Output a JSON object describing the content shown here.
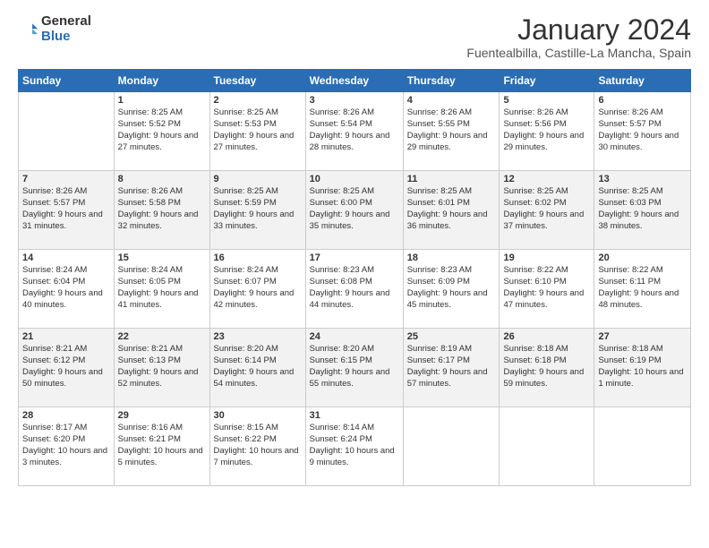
{
  "header": {
    "logo_general": "General",
    "logo_blue": "Blue",
    "month_title": "January 2024",
    "location": "Fuentealbilla, Castille-La Mancha, Spain"
  },
  "weekdays": [
    "Sunday",
    "Monday",
    "Tuesday",
    "Wednesday",
    "Thursday",
    "Friday",
    "Saturday"
  ],
  "weeks": [
    [
      {
        "num": "",
        "sunrise": "",
        "sunset": "",
        "daylight": ""
      },
      {
        "num": "1",
        "sunrise": "Sunrise: 8:25 AM",
        "sunset": "Sunset: 5:52 PM",
        "daylight": "Daylight: 9 hours and 27 minutes."
      },
      {
        "num": "2",
        "sunrise": "Sunrise: 8:25 AM",
        "sunset": "Sunset: 5:53 PM",
        "daylight": "Daylight: 9 hours and 27 minutes."
      },
      {
        "num": "3",
        "sunrise": "Sunrise: 8:26 AM",
        "sunset": "Sunset: 5:54 PM",
        "daylight": "Daylight: 9 hours and 28 minutes."
      },
      {
        "num": "4",
        "sunrise": "Sunrise: 8:26 AM",
        "sunset": "Sunset: 5:55 PM",
        "daylight": "Daylight: 9 hours and 29 minutes."
      },
      {
        "num": "5",
        "sunrise": "Sunrise: 8:26 AM",
        "sunset": "Sunset: 5:56 PM",
        "daylight": "Daylight: 9 hours and 29 minutes."
      },
      {
        "num": "6",
        "sunrise": "Sunrise: 8:26 AM",
        "sunset": "Sunset: 5:57 PM",
        "daylight": "Daylight: 9 hours and 30 minutes."
      }
    ],
    [
      {
        "num": "7",
        "sunrise": "Sunrise: 8:26 AM",
        "sunset": "Sunset: 5:57 PM",
        "daylight": "Daylight: 9 hours and 31 minutes."
      },
      {
        "num": "8",
        "sunrise": "Sunrise: 8:26 AM",
        "sunset": "Sunset: 5:58 PM",
        "daylight": "Daylight: 9 hours and 32 minutes."
      },
      {
        "num": "9",
        "sunrise": "Sunrise: 8:25 AM",
        "sunset": "Sunset: 5:59 PM",
        "daylight": "Daylight: 9 hours and 33 minutes."
      },
      {
        "num": "10",
        "sunrise": "Sunrise: 8:25 AM",
        "sunset": "Sunset: 6:00 PM",
        "daylight": "Daylight: 9 hours and 35 minutes."
      },
      {
        "num": "11",
        "sunrise": "Sunrise: 8:25 AM",
        "sunset": "Sunset: 6:01 PM",
        "daylight": "Daylight: 9 hours and 36 minutes."
      },
      {
        "num": "12",
        "sunrise": "Sunrise: 8:25 AM",
        "sunset": "Sunset: 6:02 PM",
        "daylight": "Daylight: 9 hours and 37 minutes."
      },
      {
        "num": "13",
        "sunrise": "Sunrise: 8:25 AM",
        "sunset": "Sunset: 6:03 PM",
        "daylight": "Daylight: 9 hours and 38 minutes."
      }
    ],
    [
      {
        "num": "14",
        "sunrise": "Sunrise: 8:24 AM",
        "sunset": "Sunset: 6:04 PM",
        "daylight": "Daylight: 9 hours and 40 minutes."
      },
      {
        "num": "15",
        "sunrise": "Sunrise: 8:24 AM",
        "sunset": "Sunset: 6:05 PM",
        "daylight": "Daylight: 9 hours and 41 minutes."
      },
      {
        "num": "16",
        "sunrise": "Sunrise: 8:24 AM",
        "sunset": "Sunset: 6:07 PM",
        "daylight": "Daylight: 9 hours and 42 minutes."
      },
      {
        "num": "17",
        "sunrise": "Sunrise: 8:23 AM",
        "sunset": "Sunset: 6:08 PM",
        "daylight": "Daylight: 9 hours and 44 minutes."
      },
      {
        "num": "18",
        "sunrise": "Sunrise: 8:23 AM",
        "sunset": "Sunset: 6:09 PM",
        "daylight": "Daylight: 9 hours and 45 minutes."
      },
      {
        "num": "19",
        "sunrise": "Sunrise: 8:22 AM",
        "sunset": "Sunset: 6:10 PM",
        "daylight": "Daylight: 9 hours and 47 minutes."
      },
      {
        "num": "20",
        "sunrise": "Sunrise: 8:22 AM",
        "sunset": "Sunset: 6:11 PM",
        "daylight": "Daylight: 9 hours and 48 minutes."
      }
    ],
    [
      {
        "num": "21",
        "sunrise": "Sunrise: 8:21 AM",
        "sunset": "Sunset: 6:12 PM",
        "daylight": "Daylight: 9 hours and 50 minutes."
      },
      {
        "num": "22",
        "sunrise": "Sunrise: 8:21 AM",
        "sunset": "Sunset: 6:13 PM",
        "daylight": "Daylight: 9 hours and 52 minutes."
      },
      {
        "num": "23",
        "sunrise": "Sunrise: 8:20 AM",
        "sunset": "Sunset: 6:14 PM",
        "daylight": "Daylight: 9 hours and 54 minutes."
      },
      {
        "num": "24",
        "sunrise": "Sunrise: 8:20 AM",
        "sunset": "Sunset: 6:15 PM",
        "daylight": "Daylight: 9 hours and 55 minutes."
      },
      {
        "num": "25",
        "sunrise": "Sunrise: 8:19 AM",
        "sunset": "Sunset: 6:17 PM",
        "daylight": "Daylight: 9 hours and 57 minutes."
      },
      {
        "num": "26",
        "sunrise": "Sunrise: 8:18 AM",
        "sunset": "Sunset: 6:18 PM",
        "daylight": "Daylight: 9 hours and 59 minutes."
      },
      {
        "num": "27",
        "sunrise": "Sunrise: 8:18 AM",
        "sunset": "Sunset: 6:19 PM",
        "daylight": "Daylight: 10 hours and 1 minute."
      }
    ],
    [
      {
        "num": "28",
        "sunrise": "Sunrise: 8:17 AM",
        "sunset": "Sunset: 6:20 PM",
        "daylight": "Daylight: 10 hours and 3 minutes."
      },
      {
        "num": "29",
        "sunrise": "Sunrise: 8:16 AM",
        "sunset": "Sunset: 6:21 PM",
        "daylight": "Daylight: 10 hours and 5 minutes."
      },
      {
        "num": "30",
        "sunrise": "Sunrise: 8:15 AM",
        "sunset": "Sunset: 6:22 PM",
        "daylight": "Daylight: 10 hours and 7 minutes."
      },
      {
        "num": "31",
        "sunrise": "Sunrise: 8:14 AM",
        "sunset": "Sunset: 6:24 PM",
        "daylight": "Daylight: 10 hours and 9 minutes."
      },
      {
        "num": "",
        "sunrise": "",
        "sunset": "",
        "daylight": ""
      },
      {
        "num": "",
        "sunrise": "",
        "sunset": "",
        "daylight": ""
      },
      {
        "num": "",
        "sunrise": "",
        "sunset": "",
        "daylight": ""
      }
    ]
  ]
}
